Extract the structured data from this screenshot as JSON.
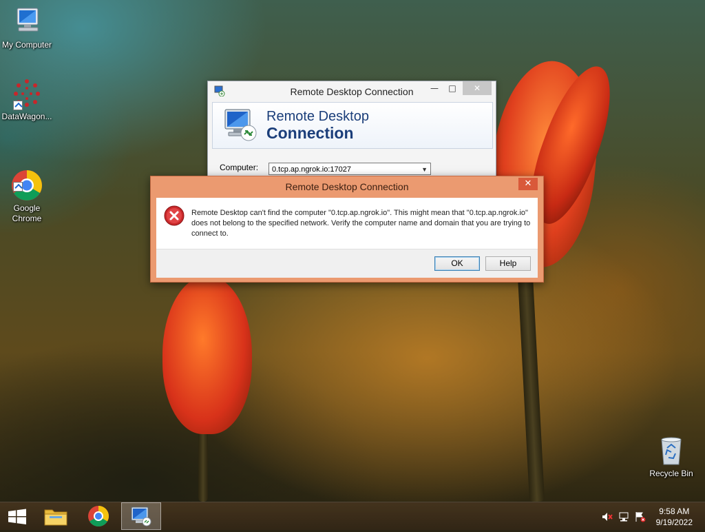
{
  "desktop": {
    "icons": [
      {
        "label": "My Computer"
      },
      {
        "label": "DataWagon..."
      },
      {
        "label": "Google\nChrome"
      },
      {
        "label": "Recycle Bin"
      }
    ]
  },
  "rdc_window": {
    "title": "Remote Desktop Connection",
    "banner_line1": "Remote Desktop",
    "banner_line2": "Connection",
    "computer_label": "Computer:",
    "computer_value": "0.tcp.ap.ngrok.io:17027"
  },
  "error_dialog": {
    "title": "Remote Desktop Connection",
    "message": "Remote Desktop can't find the computer \"0.tcp.ap.ngrok.io\". This might mean that \"0.tcp.ap.ngrok.io\" does not belong to the specified network.  Verify the computer name and domain that you are trying to connect to.",
    "ok_label": "OK",
    "help_label": "Help",
    "close_glyph": "✕"
  },
  "taskbar": {
    "time": "9:58 AM",
    "date": "9/19/2022"
  },
  "colors": {
    "error_frame": "#eb9a70",
    "error_close": "#d9593a",
    "banner_text": "#1b3e7a"
  }
}
